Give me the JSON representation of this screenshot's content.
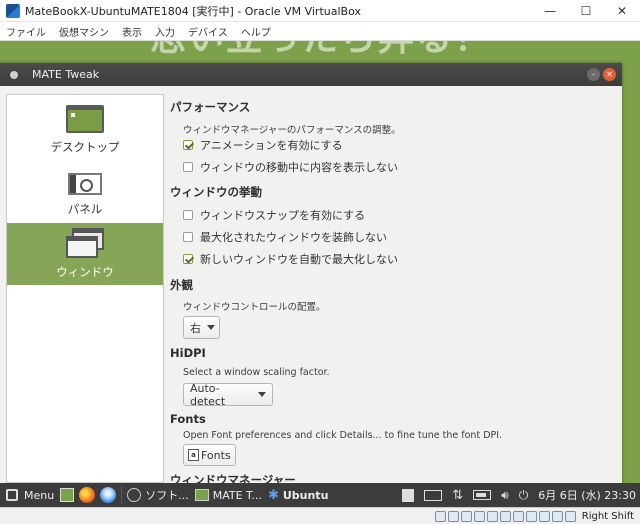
{
  "vbox": {
    "title": "MateBookX-UbuntuMATE1804 [実行中] - Oracle VM VirtualBox",
    "controls": {
      "minimize": "—",
      "maximize": "☐",
      "close": "✕"
    },
    "menu": [
      "ファイル",
      "仮想マシン",
      "表示",
      "入力",
      "デバイス",
      "ヘルプ"
    ],
    "host_key": "Right Shift"
  },
  "wallpaper_text": "思い立ったら弄る！",
  "tweak": {
    "title": "MATE Tweak",
    "sidebar": [
      {
        "label": "デスクトップ",
        "icon": "desktop-icon",
        "active": false
      },
      {
        "label": "パネル",
        "icon": "panel-icon",
        "active": false
      },
      {
        "label": "ウィンドウ",
        "icon": "window-icon",
        "active": true
      }
    ],
    "performance": {
      "title": "パフォーマンス",
      "desc": "ウィンドウマネージャーのパフォーマンスの調整。",
      "options": [
        {
          "label": "アニメーションを有効にする",
          "checked": true
        },
        {
          "label": "ウィンドウの移動中に内容を表示しない",
          "checked": false
        }
      ]
    },
    "behavior": {
      "title": "ウィンドウの挙動",
      "options": [
        {
          "label": "ウィンドウスナップを有効にする",
          "checked": false
        },
        {
          "label": "最大化されたウィンドウを装飾しない",
          "checked": false
        },
        {
          "label": "新しいウィンドウを自動で最大化しない",
          "checked": true
        }
      ]
    },
    "appearance": {
      "title": "外観",
      "desc": "ウィンドウコントロールの配置。",
      "value": "右"
    },
    "hidpi": {
      "title": "HiDPI",
      "desc": "Select a window scaling factor.",
      "value": "Auto-detect"
    },
    "fonts": {
      "title": "Fonts",
      "desc": "Open Font preferences and click Details... to fine tune the font DPI.",
      "button": "Fonts"
    },
    "wm": {
      "title": "ウィンドウマネージャー"
    }
  },
  "taskbar": {
    "menu_label": "Menu",
    "tasks": [
      {
        "label": "ソフト..."
      },
      {
        "label": "MATE T..."
      },
      {
        "label": "Ubuntu"
      }
    ],
    "clock": "6月 6日 (水) 23:30"
  }
}
